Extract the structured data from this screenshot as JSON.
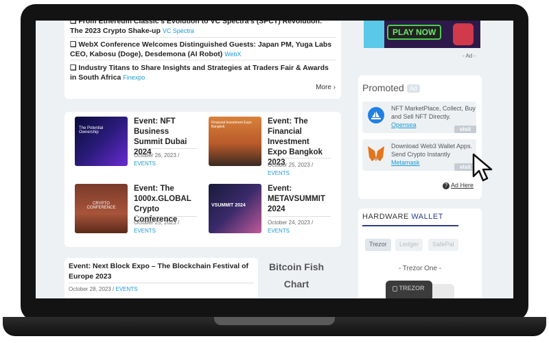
{
  "news": {
    "items": [
      {
        "title": "❏ From Ethereum Classic's Evolution to VC Spectra's (SPCT) Revolution: The 2023 Crypto Shake-up",
        "source": "VC Spectra"
      },
      {
        "title": "❏ WebX Conference Welcomes Distinguished Guests: Japan PM, Yuga Labs CEO, Kabosu (Doge), Desdemona (AI Robot)",
        "source": "WebX"
      },
      {
        "title": "❏ Industry Titans to Share Insights and Strategies at Traders Fair & Awards in South Africa",
        "source": "Finexpo"
      }
    ],
    "more_label": "More ›"
  },
  "events": [
    {
      "title": "Event: NFT Business Summit Dubai 2024",
      "date": "October 26, 2023 /",
      "category": "EVENTS",
      "thumb_text": "The Potential Ownership"
    },
    {
      "title": "Event: The Financial Investment Expo Bangkok 2023",
      "date": "October 25, 2023 /",
      "category": "EVENTS",
      "thumb_text": "Financial Investment Expo Bangkok"
    },
    {
      "title": "Event: The 1000x.GLOBAL Crypto Conference",
      "date": "October 25, 2023 /",
      "category": "EVENTS",
      "thumb_text": "CRYPTO CONFERENCE"
    },
    {
      "title": "Event: METAVSUMMIT 2024",
      "date": "October 24, 2023 /",
      "category": "EVENTS",
      "thumb_text": "VSUMMIT 2024"
    }
  ],
  "event_row": {
    "title": "Event: Next Block Expo – The Blockchain Festival of Europe 2023",
    "date": "October 28, 2023 /",
    "category": "EVENTS"
  },
  "fish_chart": {
    "line1": "Bitcoin Fish",
    "line2": "Chart"
  },
  "ad": {
    "banner_text": "PLAY NOW",
    "label": "- Ad -"
  },
  "promoted": {
    "title": "Promoted",
    "badge": "Ad",
    "items": [
      {
        "text": "NFT MarketPlace, Collect, Buy and Sell NFT Directly.",
        "link": "Opensea",
        "visit": "visit",
        "icon": "opensea-icon"
      },
      {
        "text": "Download Web3 Wallet Apps. Send Crypto Instantly",
        "link": "Metamask",
        "visit": "visit",
        "icon": "metamask-fox-icon"
      }
    ],
    "ad_here": "Ad Here"
  },
  "hardware_wallet": {
    "title_a": "HARDWARE",
    "title_b": "WALLET",
    "tabs": [
      "Trezor",
      "Ledger",
      "SafePal"
    ],
    "model": "- Trezor One -",
    "device_label": "TREZOR"
  },
  "colors": {
    "accent_link": "#1a9ad6",
    "hw_accent": "#2a3a8a",
    "bg": "#eef1f4"
  }
}
